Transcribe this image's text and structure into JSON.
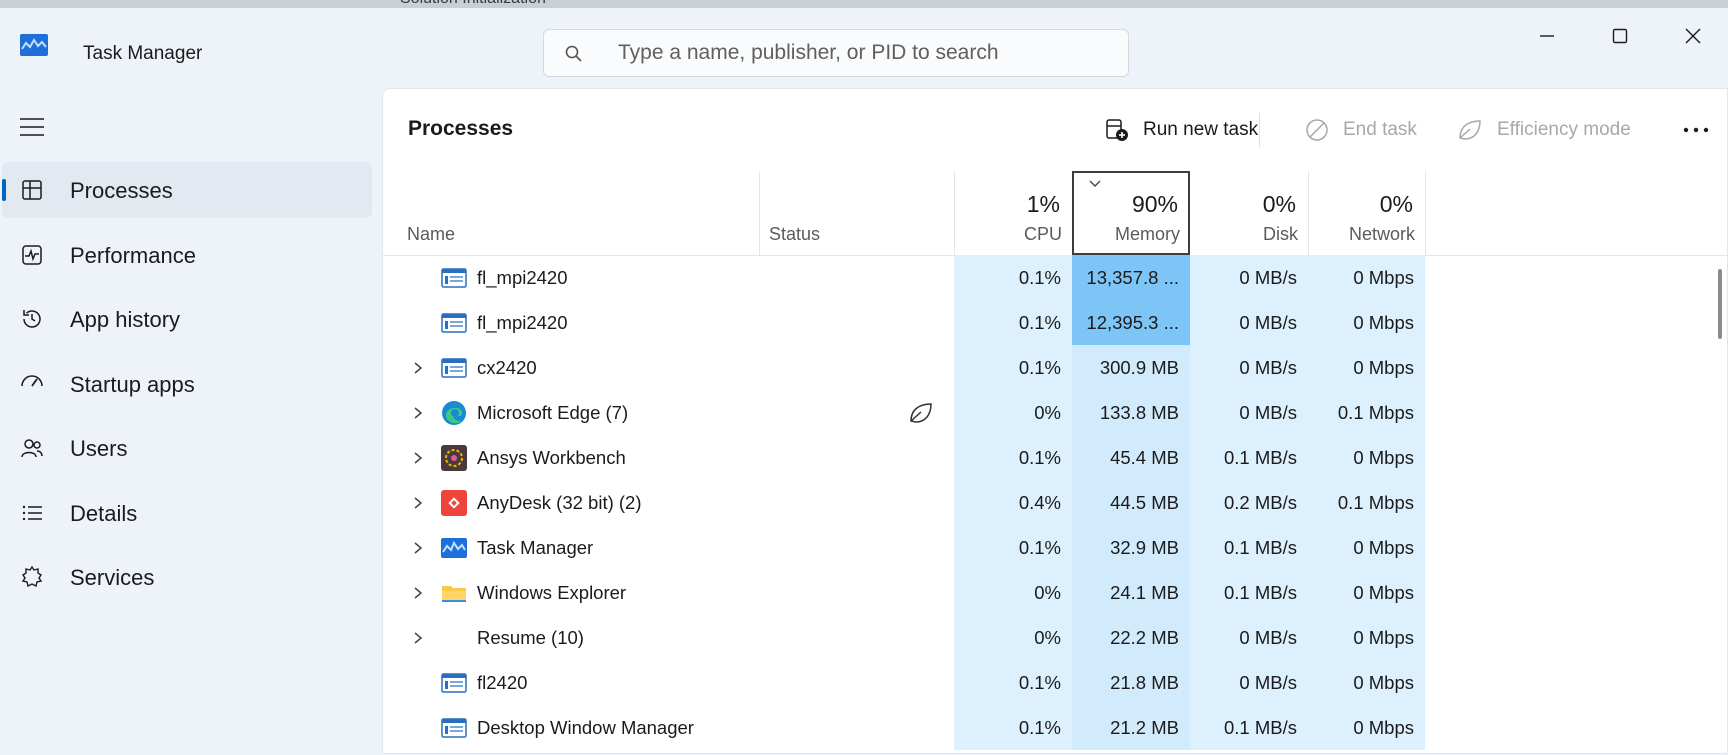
{
  "window": {
    "title": "Task Manager",
    "behind_text": "Solution Initialization"
  },
  "search": {
    "placeholder": "Type a name, publisher, or PID to search"
  },
  "nav": {
    "items": [
      {
        "label": "Processes",
        "icon": "processes-icon",
        "active": true
      },
      {
        "label": "Performance",
        "icon": "performance-icon"
      },
      {
        "label": "App history",
        "icon": "app-history-icon"
      },
      {
        "label": "Startup apps",
        "icon": "startup-apps-icon"
      },
      {
        "label": "Users",
        "icon": "users-icon"
      },
      {
        "label": "Details",
        "icon": "details-icon"
      },
      {
        "label": "Services",
        "icon": "services-icon"
      }
    ]
  },
  "panel": {
    "title": "Processes",
    "commands": {
      "run_new_task": "Run new task",
      "end_task": "End task",
      "efficiency_mode": "Efficiency mode",
      "more": "···"
    }
  },
  "columns": {
    "name": "Name",
    "status": "Status",
    "cpu": {
      "label": "CPU",
      "pct": "1%"
    },
    "memory": {
      "label": "Memory",
      "pct": "90%"
    },
    "disk": {
      "label": "Disk",
      "pct": "0%"
    },
    "network": {
      "label": "Network",
      "pct": "0%"
    }
  },
  "processes": [
    {
      "name": "fl_mpi2420",
      "cpu": "0.1%",
      "memory": "13,357.8 ...",
      "disk": "0 MB/s",
      "network": "0 Mbps",
      "expandable": false,
      "icon": "generic-app-icon",
      "mem_hot": true
    },
    {
      "name": "fl_mpi2420",
      "cpu": "0.1%",
      "memory": "12,395.3 ...",
      "disk": "0 MB/s",
      "network": "0 Mbps",
      "expandable": false,
      "icon": "generic-app-icon",
      "mem_hot": true
    },
    {
      "name": "cx2420",
      "cpu": "0.1%",
      "memory": "300.9 MB",
      "disk": "0 MB/s",
      "network": "0 Mbps",
      "expandable": true,
      "icon": "generic-app-icon"
    },
    {
      "name": "Microsoft Edge (7)",
      "cpu": "0%",
      "memory": "133.8 MB",
      "disk": "0 MB/s",
      "network": "0.1 Mbps",
      "expandable": true,
      "icon": "edge-icon",
      "efficiency": true
    },
    {
      "name": "Ansys Workbench",
      "cpu": "0.1%",
      "memory": "45.4 MB",
      "disk": "0.1 MB/s",
      "network": "0 Mbps",
      "expandable": true,
      "icon": "ansys-icon"
    },
    {
      "name": "AnyDesk (32 bit) (2)",
      "cpu": "0.4%",
      "memory": "44.5 MB",
      "disk": "0.2 MB/s",
      "network": "0.1 Mbps",
      "expandable": true,
      "icon": "anydesk-icon"
    },
    {
      "name": "Task Manager",
      "cpu": "0.1%",
      "memory": "32.9 MB",
      "disk": "0.1 MB/s",
      "network": "0 Mbps",
      "expandable": true,
      "icon": "task-manager-icon"
    },
    {
      "name": "Windows Explorer",
      "cpu": "0%",
      "memory": "24.1 MB",
      "disk": "0.1 MB/s",
      "network": "0 Mbps",
      "expandable": true,
      "icon": "folder-icon"
    },
    {
      "name": "Resume (10)",
      "cpu": "0%",
      "memory": "22.2 MB",
      "disk": "0 MB/s",
      "network": "0 Mbps",
      "expandable": true,
      "icon": ""
    },
    {
      "name": "fl2420",
      "cpu": "0.1%",
      "memory": "21.8 MB",
      "disk": "0 MB/s",
      "network": "0 Mbps",
      "expandable": false,
      "icon": "generic-app-icon"
    },
    {
      "name": "Desktop Window Manager",
      "cpu": "0.1%",
      "memory": "21.2 MB",
      "disk": "0.1 MB/s",
      "network": "0 Mbps",
      "expandable": false,
      "icon": "generic-app-icon"
    }
  ],
  "colors": {
    "accent": "#0067c0",
    "heat_light": "#ddf0fd",
    "heat_hot": "#7cc5f6"
  }
}
